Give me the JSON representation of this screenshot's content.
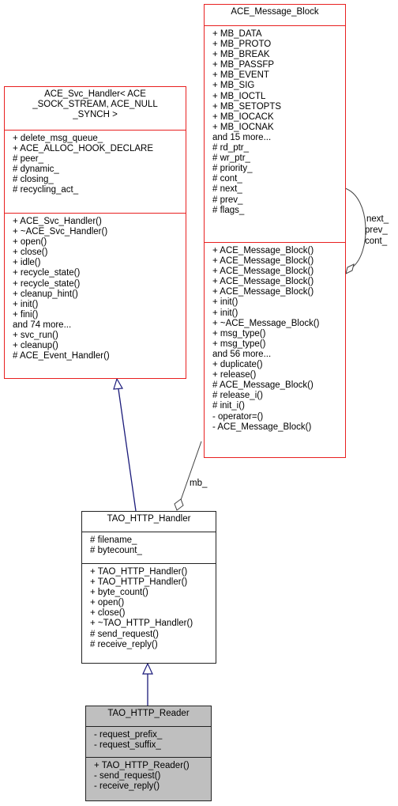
{
  "classes": {
    "svc_handler": {
      "title_lines": [
        "ACE_Svc_Handler< ACE",
        "_SOCK_STREAM, ACE_NULL",
        "_SYNCH >"
      ],
      "attributes": [
        "+ delete_msg_queue_",
        "+ ACE_ALLOC_HOOK_DECLARE",
        "# peer_",
        "# dynamic_",
        "# closing_",
        "# recycling_act_"
      ],
      "methods": [
        "+ ACE_Svc_Handler()",
        "+ ~ACE_Svc_Handler()",
        "+ open()",
        "+ close()",
        "+ idle()",
        "+ recycle_state()",
        "+ recycle_state()",
        "+ cleanup_hint()",
        "+ init()",
        "+ fini()",
        "and 74 more...",
        "+ svc_run()",
        "+ cleanup()",
        "# ACE_Event_Handler()"
      ]
    },
    "message_block": {
      "title": "ACE_Message_Block",
      "attributes": [
        "+ MB_DATA",
        "+ MB_PROTO",
        "+ MB_BREAK",
        "+ MB_PASSFP",
        "+ MB_EVENT",
        "+ MB_SIG",
        "+ MB_IOCTL",
        "+ MB_SETOPTS",
        "+ MB_IOCACK",
        "+ MB_IOCNAK",
        "and 15 more...",
        "# rd_ptr_",
        "# wr_ptr_",
        "# priority_",
        "# cont_",
        "# next_",
        "# prev_",
        "# flags_"
      ],
      "methods": [
        "+ ACE_Message_Block()",
        "+ ACE_Message_Block()",
        "+ ACE_Message_Block()",
        "+ ACE_Message_Block()",
        "+ ACE_Message_Block()",
        "+ init()",
        "+ init()",
        "+ ~ACE_Message_Block()",
        "+ msg_type()",
        "+ msg_type()",
        "and 56 more...",
        "+ duplicate()",
        "+ release()",
        "# ACE_Message_Block()",
        "# release_i()",
        "# init_i()",
        "- operator=()",
        "- ACE_Message_Block()"
      ]
    },
    "http_handler": {
      "title": "TAO_HTTP_Handler",
      "attributes": [
        "# filename_",
        "# bytecount_"
      ],
      "methods": [
        "+ TAO_HTTP_Handler()",
        "+ TAO_HTTP_Handler()",
        "+ byte_count()",
        "+ open()",
        "+ close()",
        "+ ~TAO_HTTP_Handler()",
        "# send_request()",
        "# receive_reply()"
      ]
    },
    "http_reader": {
      "title": "TAO_HTTP_Reader",
      "attributes": [
        "- request_prefix_",
        "- request_suffix_"
      ],
      "methods": [
        "+ TAO_HTTP_Reader()",
        "- send_request()",
        "- receive_reply()"
      ]
    }
  },
  "edges": {
    "self_loop_labels": [
      "next_",
      "prev_",
      "cont_"
    ],
    "member_label": "mb_"
  },
  "colors": {
    "template_border": "#e82020",
    "class_border": "#222222",
    "focus_fill": "#bfbfbf",
    "inheritance_edge": "#1a1a7a",
    "association_edge": "#404040"
  }
}
